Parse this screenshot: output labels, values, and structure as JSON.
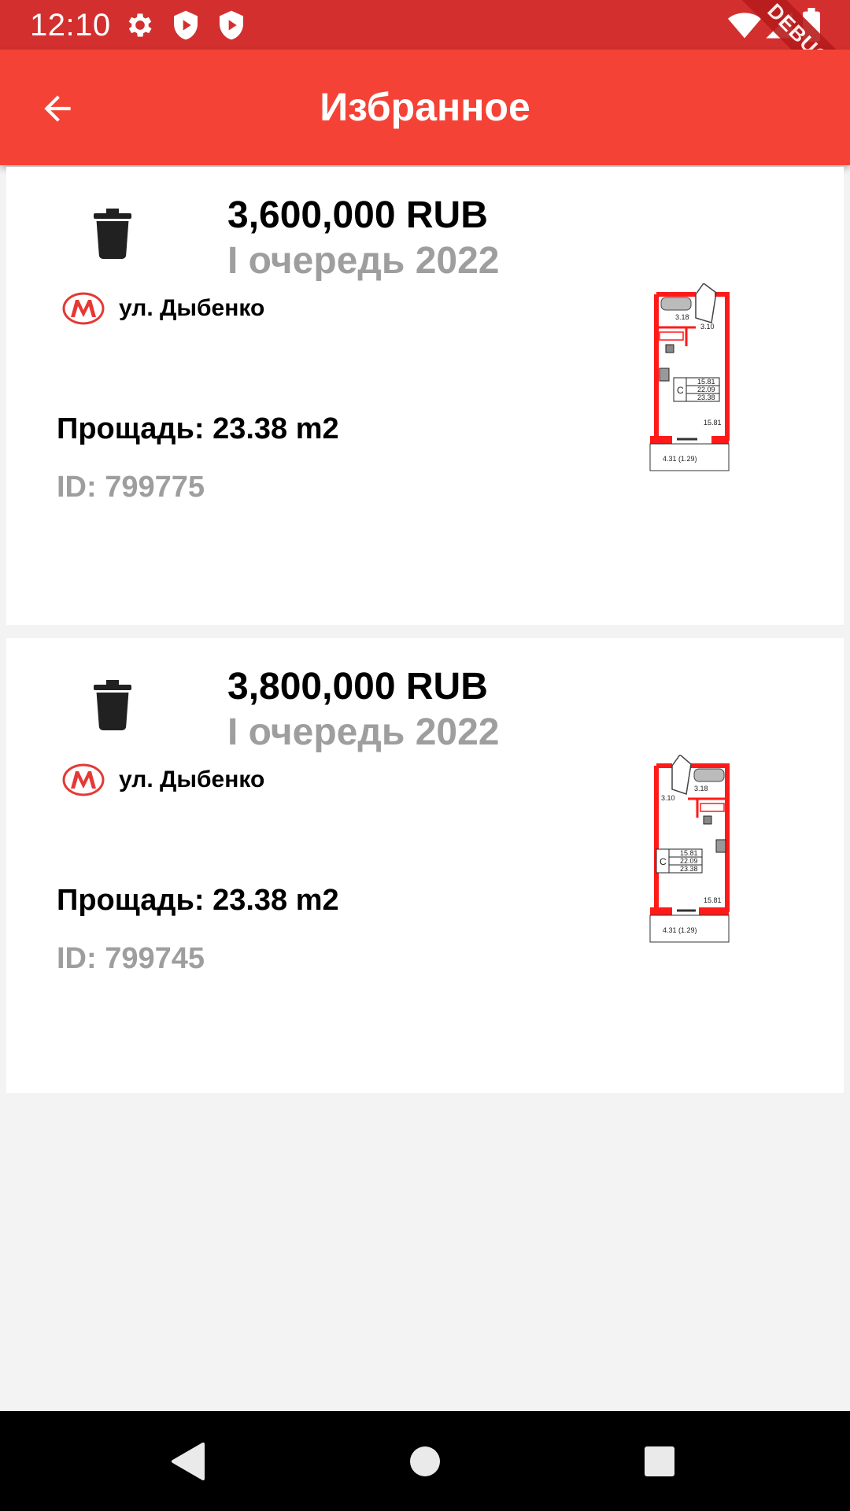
{
  "status_bar": {
    "time": "12:10",
    "left_icons": [
      "settings-icon",
      "shield-icon",
      "play-protect-icon"
    ],
    "right_icons": [
      "wifi-icon",
      "signal-icon",
      "battery-icon"
    ],
    "debug_label": "DEBUG"
  },
  "app_bar": {
    "back_icon": "arrow-back-icon",
    "title": "Избранное",
    "color": "#f44336"
  },
  "favorites": [
    {
      "price": "3,600,000 RUB",
      "queue": "I очередь 2022",
      "metro_icon": "metro-m-icon",
      "address": "ул. Дыбенко",
      "area": "Прощадь: 23.38 m2",
      "id": "ID: 799775",
      "plan_labels": [
        "3.18",
        "3.10",
        "15.81",
        "22.09",
        "23.38",
        "15.81",
        "4.31 (1.29)",
        "С"
      ]
    },
    {
      "price": "3,800,000 RUB",
      "queue": "I очередь 2022",
      "metro_icon": "metro-m-icon",
      "address": "ул. Дыбенко",
      "area": "Прощадь: 23.38 m2",
      "id": "ID: 799745",
      "plan_labels": [
        "3.18",
        "3.10",
        "15.81",
        "22.09",
        "23.38",
        "15.81",
        "4.31 (1.29)",
        "С"
      ]
    }
  ],
  "nav_bar": {
    "icons": [
      "back-triangle-icon",
      "home-circle-icon",
      "recents-square-icon"
    ]
  }
}
